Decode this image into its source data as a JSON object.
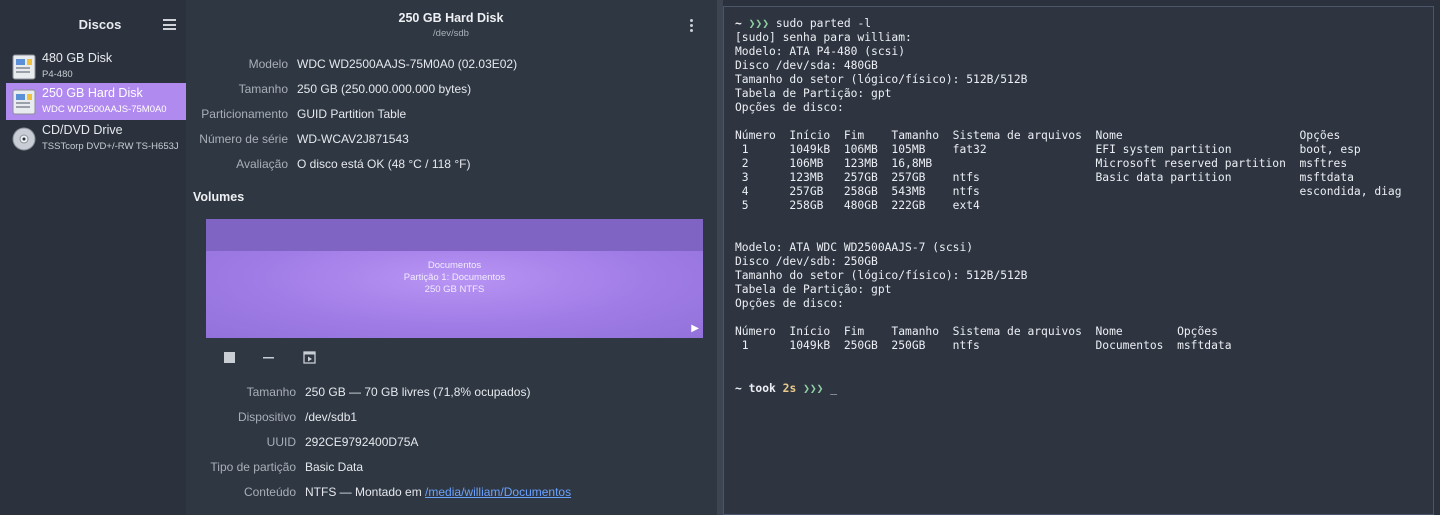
{
  "sidebar": {
    "title": "Discos",
    "menu_icon": "hamburger-menu-icon",
    "drives": [
      {
        "name": "480 GB Disk",
        "sub": "P4-480",
        "icon": "hard-disk-icon"
      },
      {
        "name": "250 GB Hard Disk",
        "sub": "WDC WD2500AAJS-75M0A0",
        "icon": "hard-disk-icon",
        "selected": true
      },
      {
        "name": "CD/DVD Drive",
        "sub": "TSSTcorp DVD+/-RW TS-H653J",
        "icon": "optical-disc-icon"
      }
    ]
  },
  "disk": {
    "title": "250 GB Hard Disk",
    "device": "/dev/sdb",
    "properties": [
      {
        "label": "Modelo",
        "value": "WDC WD2500AAJS-75M0A0 (02.03E02)"
      },
      {
        "label": "Tamanho",
        "value": "250 GB (250.000.000.000 bytes)"
      },
      {
        "label": "Particionamento",
        "value": "GUID Partition Table"
      },
      {
        "label": "Número de série",
        "value": "WD-WCAV2J871543"
      },
      {
        "label": "Avaliação",
        "value": "O disco está OK (48 °C / 118 °F)"
      }
    ]
  },
  "volumes": {
    "title": "Volumes",
    "partition_lines": [
      "Documentos",
      "Partição 1: Documentos",
      "250 GB NTFS"
    ],
    "properties": [
      {
        "label": "Tamanho",
        "value": "250 GB — 70 GB livres (71,8% ocupados)"
      },
      {
        "label": "Dispositivo",
        "value": "/dev/sdb1"
      },
      {
        "label": "UUID",
        "value": "292CE9792400D75A"
      },
      {
        "label": "Tipo de partição",
        "value": "Basic Data"
      },
      {
        "label": "Conteúdo",
        "value": "NTFS — Montado em ",
        "link": "/media/william/Documentos"
      }
    ]
  },
  "terminal": {
    "prompt_tilde": "~",
    "prompt_arrows": "❯❯❯",
    "command": "sudo parted -l",
    "output": [
      "[sudo] senha para william:",
      "Modelo: ATA P4-480 (scsi)",
      "Disco /dev/sda: 480GB",
      "Tamanho do setor (lógico/físico): 512B/512B",
      "Tabela de Partição: gpt",
      "Opções de disco:",
      "",
      "Número  Início  Fim    Tamanho  Sistema de arquivos  Nome                          Opções",
      " 1      1049kB  106MB  105MB    fat32                EFI system partition          boot, esp",
      " 2      106MB   123MB  16,8MB                        Microsoft reserved partition  msftres",
      " 3      123MB   257GB  257GB    ntfs                 Basic data partition          msftdata",
      " 4      257GB   258GB  543MB    ntfs                                               escondida, diag",
      " 5      258GB   480GB  222GB    ext4",
      "",
      "",
      "Modelo: ATA WDC WD2500AAJS-7 (scsi)",
      "Disco /dev/sdb: 250GB",
      "Tamanho do setor (lógico/físico): 512B/512B",
      "Tabela de Partição: gpt",
      "Opções de disco:",
      "",
      "Número  Início  Fim    Tamanho  Sistema de arquivos  Nome        Opções",
      " 1      1049kB  250GB  250GB    ntfs                 Documentos  msftdata"
    ],
    "prompt2_took": "took",
    "prompt2_time": "2s",
    "cursor": "_"
  }
}
